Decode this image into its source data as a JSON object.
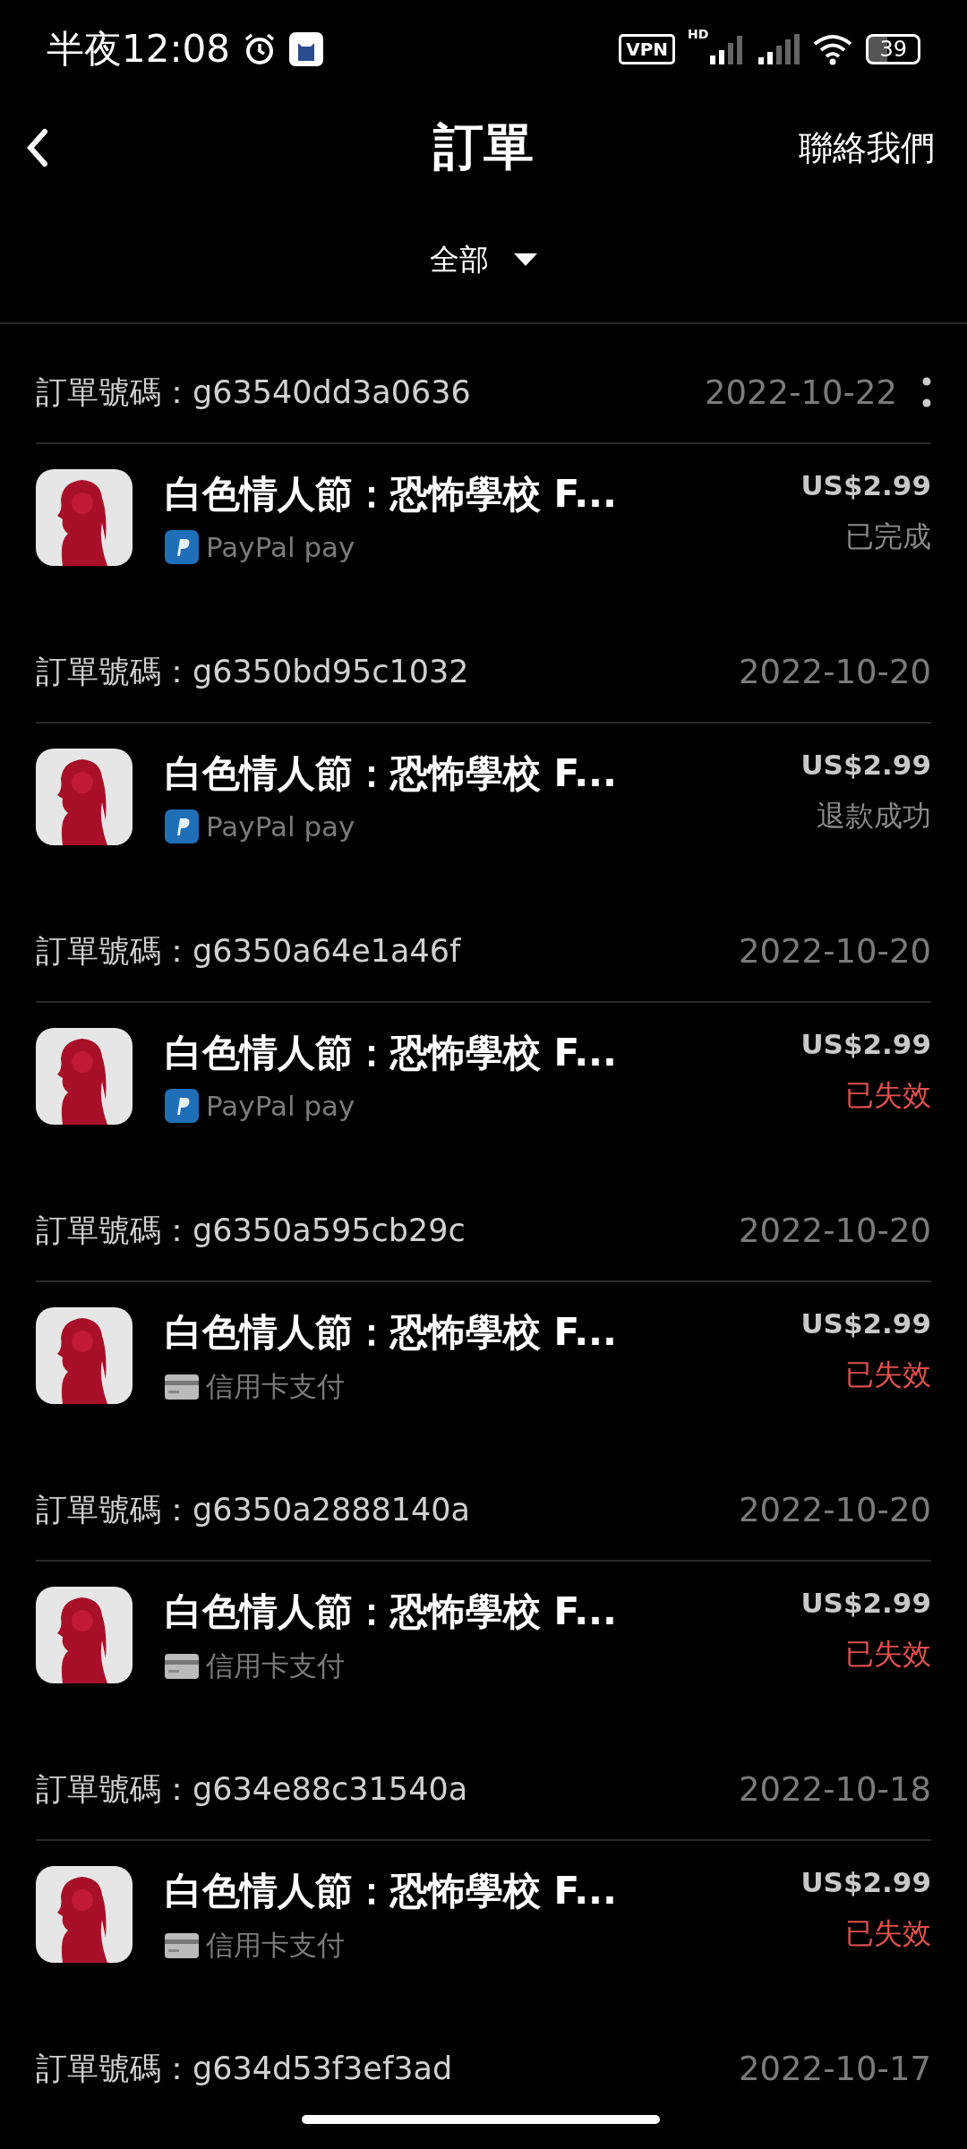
{
  "status_bar": {
    "time": "半夜12:08",
    "vpn": "VPN",
    "network": "HD",
    "battery": "39"
  },
  "header": {
    "title": "訂單",
    "action": "聯絡我們"
  },
  "filter": {
    "label": "全部"
  },
  "orders": [
    {
      "number_label": "訂單號碼：g63540dd3a0636",
      "date": "2022-10-22",
      "has_menu": true,
      "title": "白色情人節：恐怖學校 F...",
      "kind": "paypal",
      "payment": "PayPal pay",
      "price": "US$2.99",
      "status": "已完成",
      "color": "#8a8a8a"
    },
    {
      "number_label": "訂單號碼：g6350bd95c1032",
      "date": "2022-10-20",
      "has_menu": false,
      "title": "白色情人節：恐怖學校 F...",
      "kind": "paypal",
      "payment": "PayPal pay",
      "price": "US$2.99",
      "status": "退款成功",
      "color": "#8a8a8a"
    },
    {
      "number_label": "訂單號碼：g6350a64e1a46f",
      "date": "2022-10-20",
      "has_menu": false,
      "title": "白色情人節：恐怖學校 F...",
      "kind": "paypal",
      "payment": "PayPal pay",
      "price": "US$2.99",
      "status": "已失效",
      "color": "#e0504e"
    },
    {
      "number_label": "訂單號碼：g6350a595cb29c",
      "date": "2022-10-20",
      "has_menu": false,
      "title": "白色情人節：恐怖學校 F...",
      "kind": "card",
      "payment": "信用卡支付",
      "price": "US$2.99",
      "status": "已失效",
      "color": "#e0504e"
    },
    {
      "number_label": "訂單號碼：g6350a2888140a",
      "date": "2022-10-20",
      "has_menu": false,
      "title": "白色情人節：恐怖學校 F...",
      "kind": "card",
      "payment": "信用卡支付",
      "price": "US$2.99",
      "status": "已失效",
      "color": "#e0504e"
    },
    {
      "number_label": "訂單號碼：g634e88c31540a",
      "date": "2022-10-18",
      "has_menu": false,
      "title": "白色情人節：恐怖學校 F...",
      "kind": "card",
      "payment": "信用卡支付",
      "price": "US$2.99",
      "status": "已失效",
      "color": "#e0504e"
    },
    {
      "number_label": "訂單號碼：g634d53f3ef3ad",
      "date": "2022-10-17",
      "has_menu": false
    }
  ]
}
